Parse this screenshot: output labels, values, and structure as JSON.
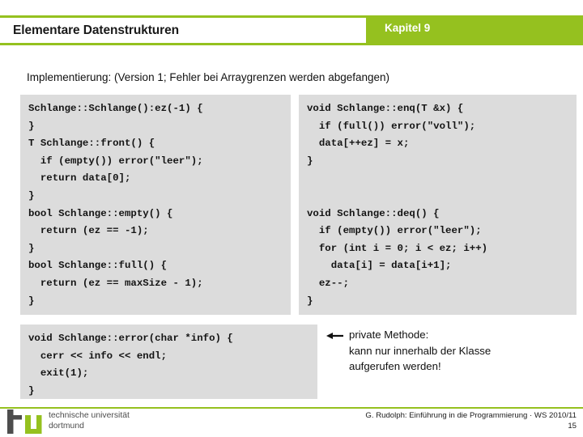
{
  "header": {
    "title": "Elementare Datenstrukturen",
    "chapter": "Kapitel 9",
    "accent_color": "#95c11f"
  },
  "subtitle": "Implementierung: (Version 1; Fehler bei Arraygrenzen werden abgefangen)",
  "code_left": {
    "lines": [
      "Schlange::Schlange():ez(-1) {",
      "}",
      "T Schlange::front() {",
      "  if (empty()) error(\"leer\");",
      "  return data[0];",
      "}",
      "bool Schlange::empty() {",
      "  return (ez == -1);",
      "}",
      "bool Schlange::full() {",
      "  return (ez == maxSize - 1);",
      "}"
    ]
  },
  "code_right": {
    "lines": [
      "void Schlange::enq(T &x) {",
      "  if (full()) error(\"voll\");",
      "  data[++ez] = x;",
      "}",
      "",
      "",
      "void Schlange::deq() {",
      "  if (empty()) error(\"leer\");",
      "  for (int i = 0; i < ez; i++)",
      "    data[i] = data[i+1];",
      "  ez--;",
      "}"
    ]
  },
  "code_bottom": {
    "lines": [
      "void Schlange::error(char *info) {",
      "  cerr << info << endl;",
      "  exit(1);",
      "}"
    ]
  },
  "annotation": {
    "arrow": "left-arrow-icon",
    "text": "private Methode:\nkann nur innerhalb der Klasse\naufgerufen werden!"
  },
  "footer": {
    "logo_mark": "tu-dortmund-logo",
    "logo_text": "technische universität\ndortmund",
    "credit": "G. Rudolph: Einführung in die Programmierung · WS 2010/11",
    "page_number": "15"
  }
}
